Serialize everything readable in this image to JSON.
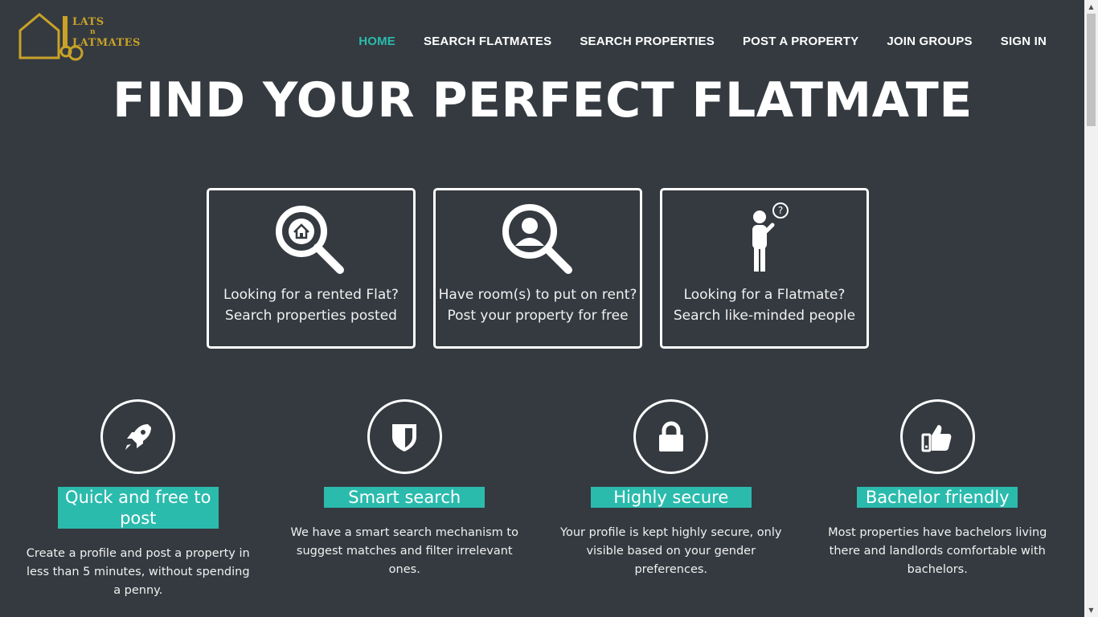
{
  "logo": {
    "line1": "LATS",
    "line2": "n",
    "line3": "LATMATES"
  },
  "nav": [
    {
      "label": "HOME",
      "active": true
    },
    {
      "label": "SEARCH FLATMATES"
    },
    {
      "label": "SEARCH PROPERTIES"
    },
    {
      "label": "POST A PROPERTY"
    },
    {
      "label": "JOIN GROUPS"
    },
    {
      "label": "SIGN IN"
    }
  ],
  "hero": {
    "title": "FIND YOUR PERFECT FLATMATE"
  },
  "cards": [
    {
      "icon": "house-search-icon",
      "line1": "Looking for a rented Flat?",
      "line2": "Search properties posted"
    },
    {
      "icon": "person-search-icon",
      "line1": "Have room(s) to put on rent?",
      "line2": "Post your property for free"
    },
    {
      "icon": "thinking-person-icon",
      "line1": "Looking for a Flatmate?",
      "line2": "Search like-minded people"
    }
  ],
  "features": [
    {
      "icon": "rocket-icon",
      "title": "Quick and free to post",
      "desc": "Create a profile and post a property in less than 5 minutes, without spending a penny."
    },
    {
      "icon": "shield-icon",
      "title": "Smart search",
      "desc": "We have a smart search mechanism to suggest matches and filter irrelevant ones."
    },
    {
      "icon": "lock-icon",
      "title": "Highly secure",
      "desc": "Your profile is kept highly secure, only visible based on your gender preferences."
    },
    {
      "icon": "thumbs-up-icon",
      "title": "Bachelor friendly",
      "desc": "Most properties have bachelors living there and landlords comfortable with bachelors."
    }
  ],
  "colors": {
    "background": "#343a40",
    "accent": "#2bbbad",
    "logo": "#c9a227"
  }
}
